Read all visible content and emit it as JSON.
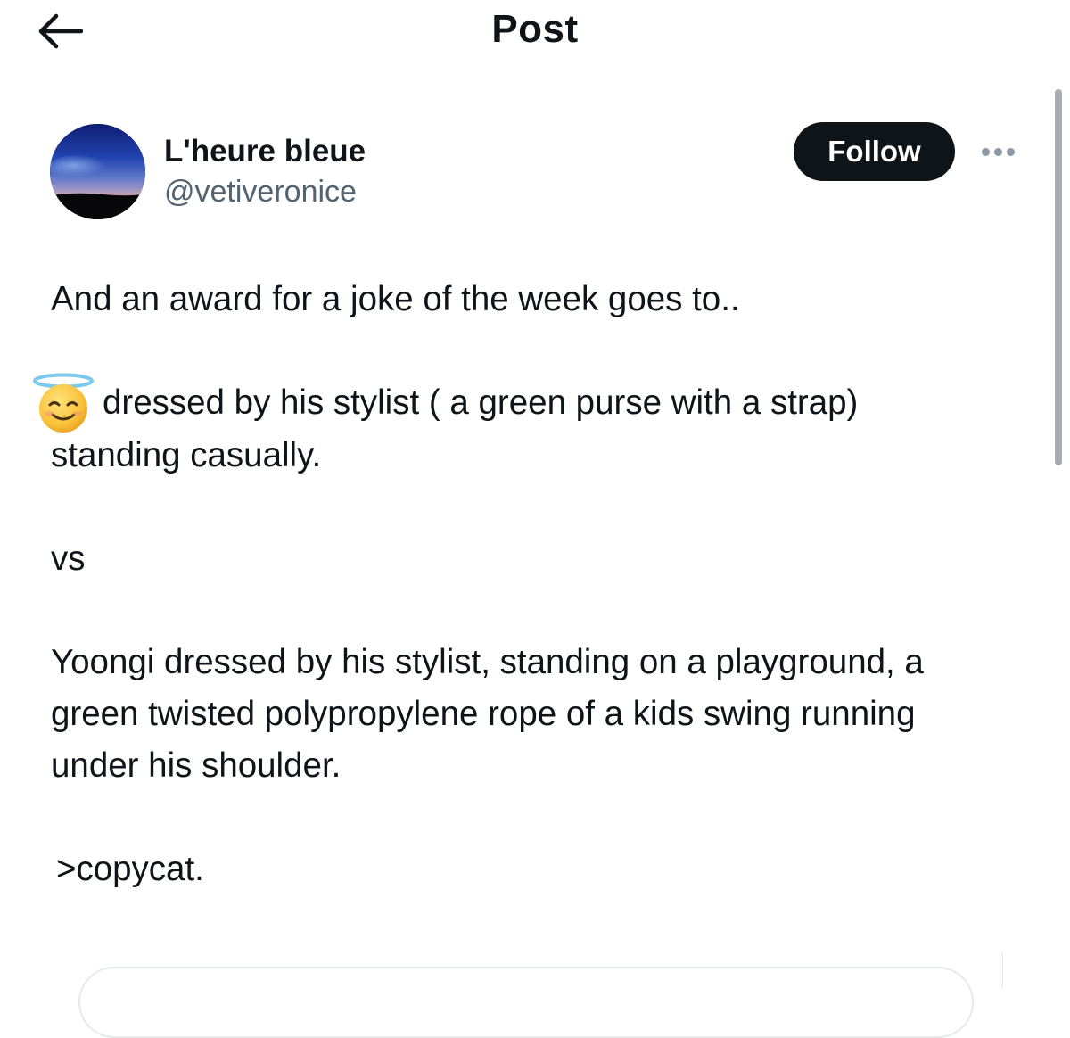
{
  "header": {
    "title": "Post",
    "back_icon": "arrow-left-icon"
  },
  "author": {
    "name": "L'heure bleue",
    "handle": "@vetiveronice",
    "follow_label": "Follow",
    "more_icon": "more-horizontal-icon"
  },
  "post": {
    "line1": "And an award for a joke of the week goes to..",
    "emoji": "smiling-face-with-halo-icon",
    "line2": "dressed by his stylist ( a green purse with a strap)",
    "line3": "standing casually.",
    "line4": "vs",
    "line5": "Yoongi dressed by his stylist, standing on a playground, a",
    "line6": "green twisted polypropylene rope of a kids swing running",
    "line7": "under his shoulder.",
    "line8": ">copycat."
  },
  "colors": {
    "text": "#0f1419",
    "secondary_text": "#536471",
    "follow_bg": "#0f1419",
    "follow_text": "#ffffff"
  }
}
